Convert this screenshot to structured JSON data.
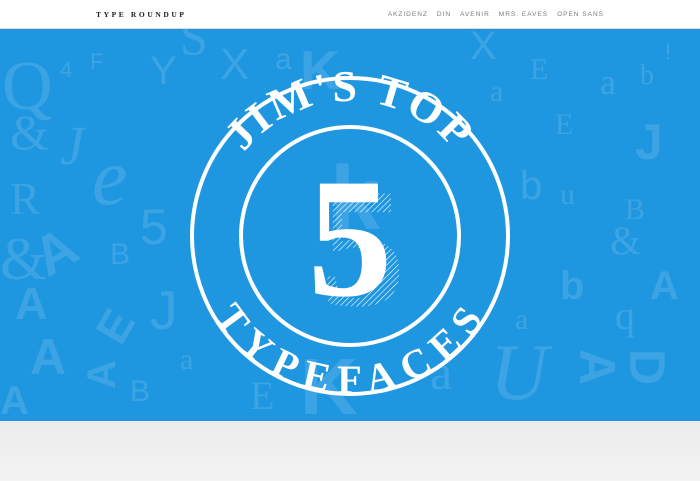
{
  "header": {
    "brand": "TYPE ROUNDUP",
    "nav": [
      "AKZIDENZ",
      "DIN",
      "AVENIR",
      "MRS. EAVES",
      "OPEN SANS"
    ]
  },
  "hero": {
    "badge_top_text": "JIM'S TOP",
    "badge_number": "5",
    "badge_bottom_text": "TYPEFACES"
  },
  "colors": {
    "hero_bg": "#1f97e0",
    "badge_white": "#ffffff",
    "nav_gray": "#7a7a7a"
  }
}
